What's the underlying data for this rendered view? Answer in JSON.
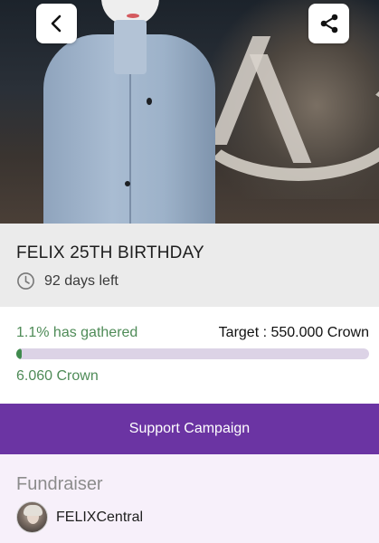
{
  "campaign": {
    "title": "FELIX 25TH BIRTHDAY",
    "days_left": "92 days left"
  },
  "progress": {
    "gathered_label": "1.1% has gathered",
    "gathered_fraction": 0.011,
    "target_label": "Target : 550.000 Crown",
    "raised_label": "6.060 Crown"
  },
  "actions": {
    "support_label": "Support Campaign"
  },
  "fundraiser": {
    "heading": "Fundraiser",
    "name": "FELIXCentral"
  },
  "icons": {
    "back": "chevron-left-icon",
    "share": "share-icon",
    "clock": "clock-icon"
  },
  "colors": {
    "accent": "#6b34a3",
    "progress_green": "#3f8a4d",
    "gathered_text": "#4e8b57",
    "track": "#dcd3e6"
  }
}
